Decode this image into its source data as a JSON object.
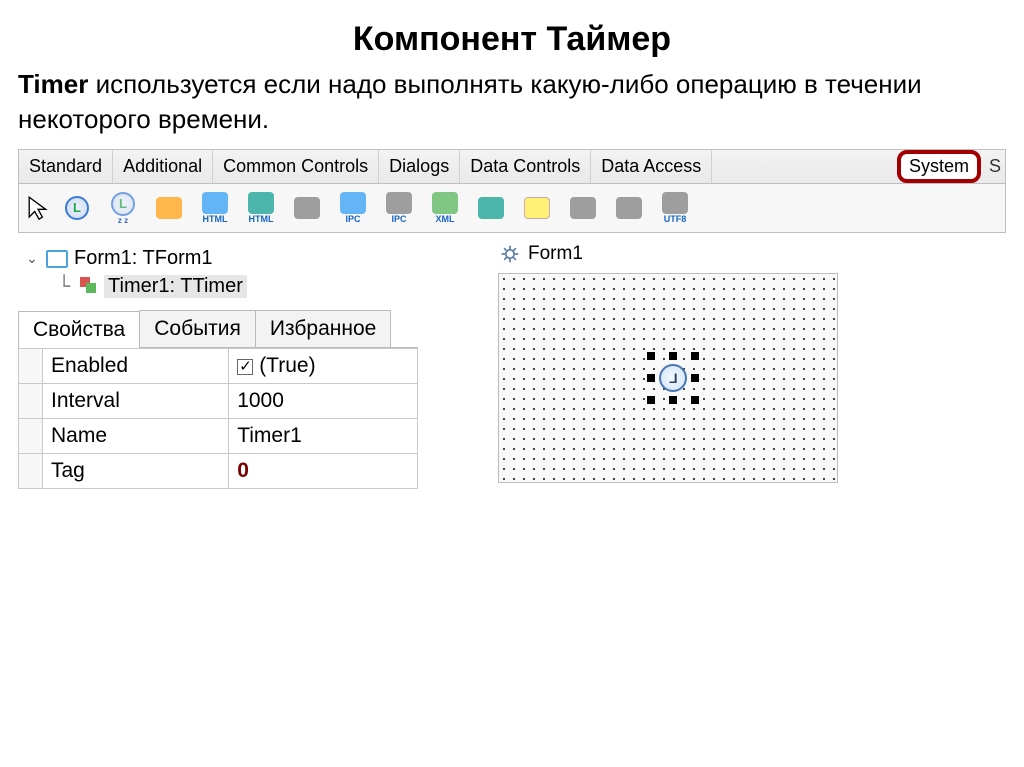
{
  "title": "Компонент Таймер",
  "description_bold": "Timer",
  "description_rest": " используется если надо выполнять какую-либо операцию в течении некоторого времени.",
  "palette_tabs": [
    "Standard",
    "Additional",
    "Common Controls",
    "Dialogs",
    "Data Controls",
    "Data Access"
  ],
  "system_tab": "System",
  "toolbar_icons": [
    {
      "name": "timer",
      "label": ""
    },
    {
      "name": "idle-timer",
      "label": ""
    },
    {
      "name": "something",
      "label": ""
    },
    {
      "name": "html1",
      "label": "HTML"
    },
    {
      "name": "html2",
      "label": "HTML"
    },
    {
      "name": "process",
      "label": ""
    },
    {
      "name": "ipc1",
      "label": "IPC"
    },
    {
      "name": "ipc2",
      "label": "IPC"
    },
    {
      "name": "xml",
      "label": "XML"
    },
    {
      "name": "list",
      "label": ""
    },
    {
      "name": "brush",
      "label": ""
    },
    {
      "name": "gear1",
      "label": ""
    },
    {
      "name": "gear2",
      "label": ""
    },
    {
      "name": "utf8",
      "label": "UTF8"
    }
  ],
  "tree": {
    "root": "Form1: TForm1",
    "child": "Timer1: TTimer"
  },
  "inspector_tabs": {
    "t1": "Свойства",
    "t2": "События",
    "t3": "Избранное"
  },
  "props": [
    {
      "name": "Enabled",
      "value": "(True)",
      "checkbox": true,
      "checked": true
    },
    {
      "name": "Interval",
      "value": "1000"
    },
    {
      "name": "Name",
      "value": "Timer1"
    },
    {
      "name": "Tag",
      "value": "0",
      "boldred": true
    }
  ],
  "designer_title": "Form1"
}
